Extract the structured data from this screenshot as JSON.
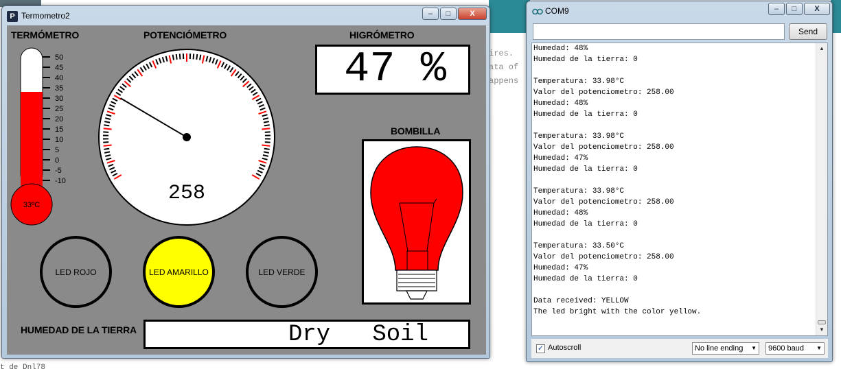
{
  "background": {
    "doc_lines": [
      "ires.",
      "ata of",
      "appens"
    ],
    "bottom_text": "t_de_Dnl78"
  },
  "termometro_window": {
    "title": "Termometro2",
    "icon": "P",
    "controls": {
      "minimize": "–",
      "maximize": "□",
      "close": "X"
    },
    "thermometer": {
      "label": "TERMÓMETRO",
      "ticks": [
        "50",
        "45",
        "40",
        "35",
        "30",
        "25",
        "20",
        "15",
        "10",
        "5",
        "0",
        "-5",
        "-10"
      ],
      "bulb_text": "33ºC",
      "value": 33,
      "scale_min": -10,
      "scale_max": 50,
      "fill_color": "#ff0000"
    },
    "potentiometer": {
      "label": "POTENCIÓMETRO",
      "value_text": "258",
      "value": 258,
      "max": 1023,
      "accent_color": "#ff0000"
    },
    "hygrometer": {
      "label": "HIGRÓMETRO",
      "value_text": "47 %"
    },
    "bulb": {
      "label": "BOMBILLA",
      "color": "#ff0000"
    },
    "leds": [
      {
        "label": "LED ROJO",
        "on": false
      },
      {
        "label": "LED AMARILLO",
        "on": true,
        "color": "#ffff00"
      },
      {
        "label": "LED VERDE",
        "on": false
      }
    ],
    "soil": {
      "label": "HUMEDAD DE LA TIERRA",
      "value_text": "Dry   Soil"
    }
  },
  "com_window": {
    "title": "COM9",
    "controls": {
      "minimize": "–",
      "maximize": "□",
      "close": "X"
    },
    "input_value": "",
    "send_label": "Send",
    "console_lines": [
      "Humedad: 48%",
      "Humedad de la tierra: 0",
      "",
      "Temperatura: 33.98°C",
      "Valor del potenciometro: 258.00",
      "Humedad: 48%",
      "Humedad de la tierra: 0",
      "",
      "Temperatura: 33.98°C",
      "Valor del potenciometro: 258.00",
      "Humedad: 47%",
      "Humedad de la tierra: 0",
      "",
      "Temperatura: 33.98°C",
      "Valor del potenciometro: 258.00",
      "Humedad: 48%",
      "Humedad de la tierra: 0",
      "",
      "Temperatura: 33.50°C",
      "Valor del potenciometro: 258.00",
      "Humedad: 47%",
      "Humedad de la tierra: 0",
      "",
      "Data received: YELLOW",
      "The led bright with the color yellow."
    ],
    "autoscroll_label": "Autoscroll",
    "autoscroll_checked": true,
    "line_ending": "No line ending",
    "baud": "9600 baud"
  }
}
